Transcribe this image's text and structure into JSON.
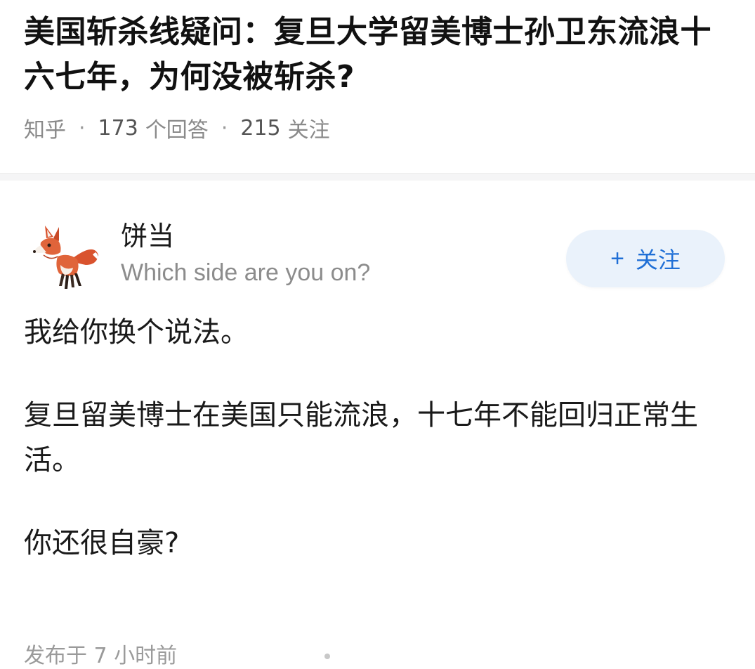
{
  "question": {
    "title": "美国斩杀线疑问：复旦大学留美博士孙卫东流浪十六七年，为何没被斩杀?",
    "source": "知乎",
    "answers_count": "173",
    "answers_label": "个回答",
    "followers_count": "215",
    "followers_label": "关注"
  },
  "answer": {
    "author_name": "饼当",
    "author_bio": "Which side are you on?",
    "avatar_icon": "fox-avatar-icon",
    "follow_button": {
      "plus": "+",
      "label": "关注"
    },
    "paragraphs": [
      "我给你换个说法。",
      "复旦留美博士在美国只能流浪，十七年不能回归正常生活。",
      "你还很自豪?"
    ],
    "publish_time": "发布于 7 小时前"
  },
  "colors": {
    "accent_blue": "#1f6fd6",
    "follow_bg": "#eaf2fb",
    "muted_text": "#8a8a8a"
  }
}
